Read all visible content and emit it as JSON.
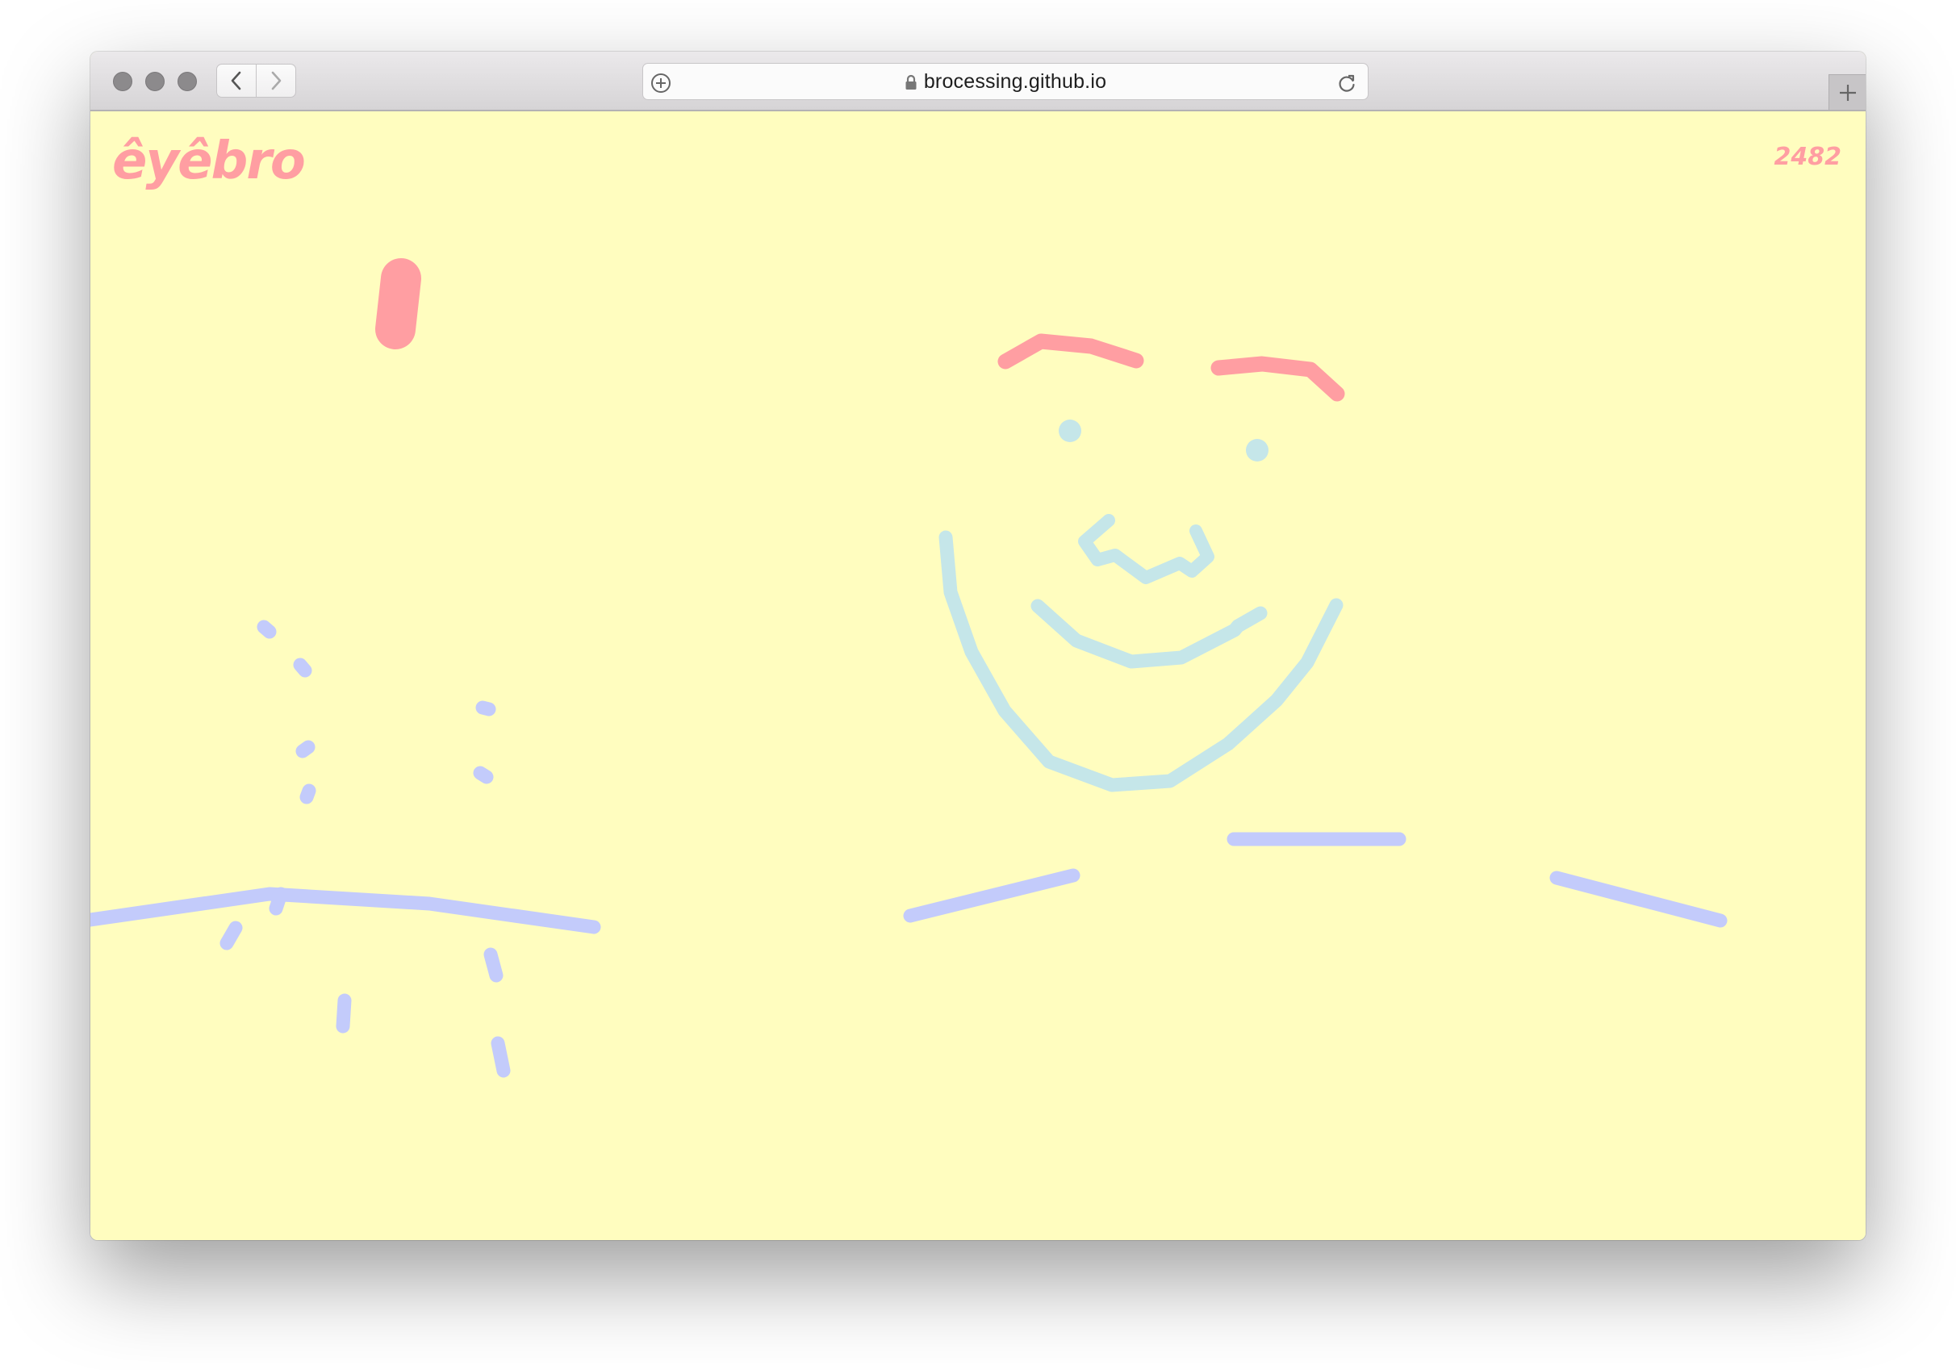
{
  "browser": {
    "url": "brocessing.github.io",
    "icons": {
      "back": "chevron-left-icon",
      "forward": "chevron-right-icon",
      "share": "plus-circle-icon",
      "lock": "lock-icon",
      "reload": "reload-icon",
      "new_tab": "plus-icon"
    }
  },
  "app": {
    "logo": "êyêbro",
    "count": "2482"
  },
  "colors": {
    "background": "#fffdbf",
    "accent_pink": "#ff9ea2",
    "stroke_light_blue": "#c5e6e9",
    "stroke_lavender": "#c3cbfb"
  }
}
